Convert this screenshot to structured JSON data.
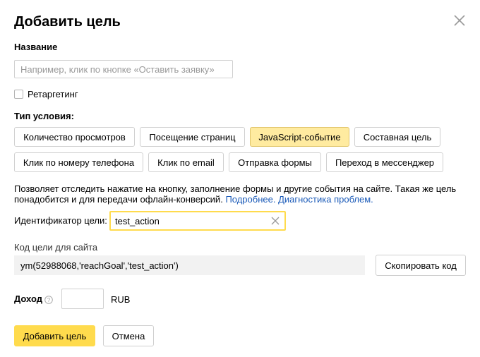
{
  "dialog": {
    "title": "Добавить цель",
    "close_icon": "close-icon"
  },
  "name_field": {
    "label": "Название",
    "value": "",
    "placeholder": "Например, клик по кнопке «Оставить заявку»"
  },
  "retargeting": {
    "label": "Ретаргетинг",
    "checked": false
  },
  "condition_type": {
    "label": "Тип условия:",
    "options": [
      {
        "label": "Количество просмотров",
        "selected": false
      },
      {
        "label": "Посещение страниц",
        "selected": false
      },
      {
        "label": "JavaScript-событие",
        "selected": true
      },
      {
        "label": "Составная цель",
        "selected": false
      },
      {
        "label": "Клик по номеру телефона",
        "selected": false
      },
      {
        "label": "Клик по email",
        "selected": false
      },
      {
        "label": "Отправка формы",
        "selected": false
      },
      {
        "label": "Переход в мессенджер",
        "selected": false
      }
    ]
  },
  "description": {
    "text": "Позволяет отследить нажатие на кнопку, заполнение формы и другие события на сайте. Такая же цель понадобится и для передачи офлайн-конверсий.",
    "link_more": "Подробнее.",
    "link_diagnostics": "Диагностика проблем."
  },
  "goal_id": {
    "label": "Идентификатор цели:",
    "value": "test_action",
    "clear_icon": "clear-icon"
  },
  "site_code": {
    "label": "Код цели для сайта",
    "code": "ym(52988068,'reachGoal','test_action')",
    "copy_button": "Скопировать код"
  },
  "income": {
    "label": "Доход",
    "help_icon": "question-circle-icon",
    "value": "",
    "currency": "RUB"
  },
  "footer": {
    "add_button": "Добавить цель",
    "cancel_button": "Отмена"
  },
  "colors": {
    "accent_yellow": "#ffdb4d",
    "selected_chip": "#ffeba0",
    "link": "#1a5ab8",
    "code_bg": "#f2f2f2"
  }
}
